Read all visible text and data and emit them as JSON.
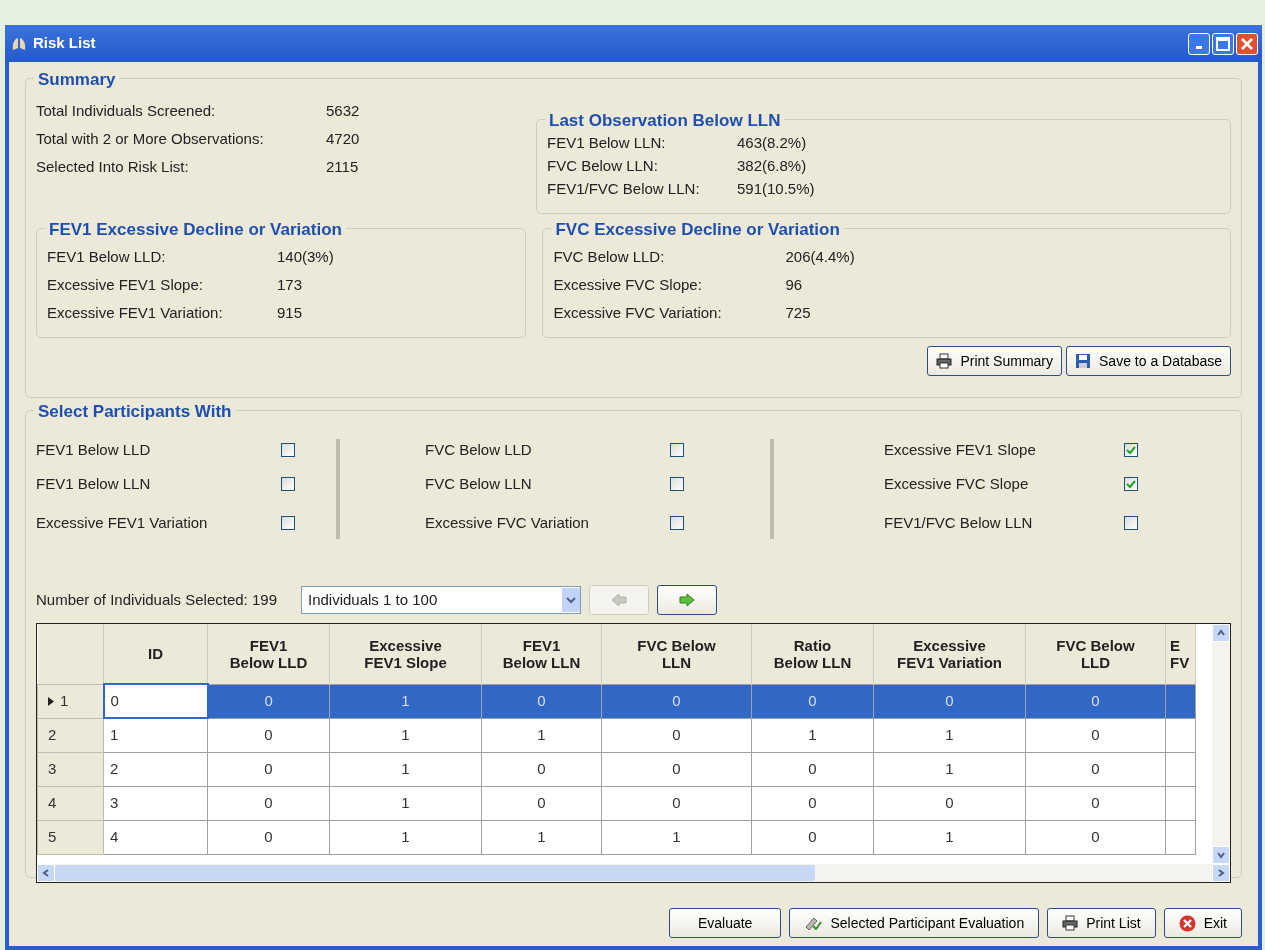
{
  "window": {
    "title": "Risk List"
  },
  "summary": {
    "legend": "Summary",
    "rows": [
      {
        "label": "Total Individuals Screened:",
        "value": "5632"
      },
      {
        "label": "Total with 2 or More Observations:",
        "value": "4720"
      },
      {
        "label": "Selected Into Risk List:",
        "value": "2115"
      }
    ]
  },
  "groups": [
    {
      "legend": "Last Observation Below LLN",
      "rows": [
        {
          "label": "FEV1  Below LLN:",
          "value": "463(8.2%)"
        },
        {
          "label": "FVC  Below LLN:",
          "value": "382(6.8%)"
        },
        {
          "label": "FEV1/FVC  Below LLN:",
          "value": "591(10.5%)"
        }
      ]
    },
    {
      "legend": "FEV1 Excessive Decline or Variation",
      "rows": [
        {
          "label": "FEV1  Below LLD:",
          "value": "140(3%)"
        },
        {
          "label": "Excessive FEV1 Slope:",
          "value": "173"
        },
        {
          "label": "Excessive FEV1 Variation:",
          "value": "915"
        }
      ]
    },
    {
      "legend": "FVC Excessive Decline or Variation",
      "rows": [
        {
          "label": "FVC  Below LLD:",
          "value": "206(4.4%)"
        },
        {
          "label": "Excessive FVC Slope:",
          "value": "96"
        },
        {
          "label": "Excessive FVC Variation:",
          "value": "725"
        }
      ]
    }
  ],
  "summary_buttons": [
    {
      "label": "Print Summary",
      "kind": "print"
    },
    {
      "label": "Save to a Database",
      "kind": "save"
    }
  ],
  "select": {
    "legend": "Select Participants With",
    "columns": [
      [
        {
          "label": "FEV1  Below LLD",
          "checked": false
        },
        {
          "label": "FEV1  Below LLN",
          "checked": false
        },
        {
          "label": "Excessive FEV1 Variation",
          "checked": false
        }
      ],
      [
        {
          "label": "FVC  Below LLD",
          "checked": false
        },
        {
          "label": "FVC  Below LLN",
          "checked": false
        },
        {
          "label": "Excessive FVC Variation",
          "checked": false
        }
      ],
      [
        {
          "label": "Excessive FEV1 Slope",
          "checked": true
        },
        {
          "label": "Excessive FVC Slope",
          "checked": true
        },
        {
          "label": "FEV1/FVC  Below LLN",
          "checked": false
        }
      ]
    ]
  },
  "count_label": "Number of Individuals Selected: 199",
  "range_dropdown": {
    "value": "Individuals 1 to 100"
  },
  "nav_buttons": [
    {
      "kind": "prev",
      "disabled": true
    },
    {
      "kind": "next",
      "disabled": false
    }
  ],
  "table": {
    "columns": [
      "ID",
      "FEV1\nBelow LLD",
      "Excessive\nFEV1 Slope",
      "FEV1\nBelow LLN",
      "FVC Below\nLLN",
      "Ratio\nBelow LLN",
      "Excessive\nFEV1 Variation",
      "FVC Below\nLLD",
      "E\nFV"
    ],
    "rows": [
      {
        "header": "1",
        "selected": true,
        "cells": [
          "0",
          "0",
          "1",
          "0",
          "0",
          "0",
          "0",
          "0"
        ]
      },
      {
        "header": "2",
        "selected": false,
        "cells": [
          "1",
          "0",
          "1",
          "1",
          "0",
          "1",
          "1",
          "0"
        ]
      },
      {
        "header": "3",
        "selected": false,
        "cells": [
          "2",
          "0",
          "1",
          "0",
          "0",
          "0",
          "1",
          "0"
        ]
      },
      {
        "header": "4",
        "selected": false,
        "cells": [
          "3",
          "0",
          "1",
          "0",
          "0",
          "0",
          "0",
          "0"
        ]
      },
      {
        "header": "5",
        "selected": false,
        "cells": [
          "4",
          "0",
          "1",
          "1",
          "1",
          "0",
          "1",
          "0"
        ]
      }
    ]
  },
  "footer_buttons": [
    {
      "label": "Evaluate",
      "kind": "plain"
    },
    {
      "label": "Selected Participant Evaluation",
      "kind": "evaluate"
    },
    {
      "label": "Print List",
      "kind": "print"
    },
    {
      "label": "Exit",
      "kind": "exit"
    }
  ]
}
